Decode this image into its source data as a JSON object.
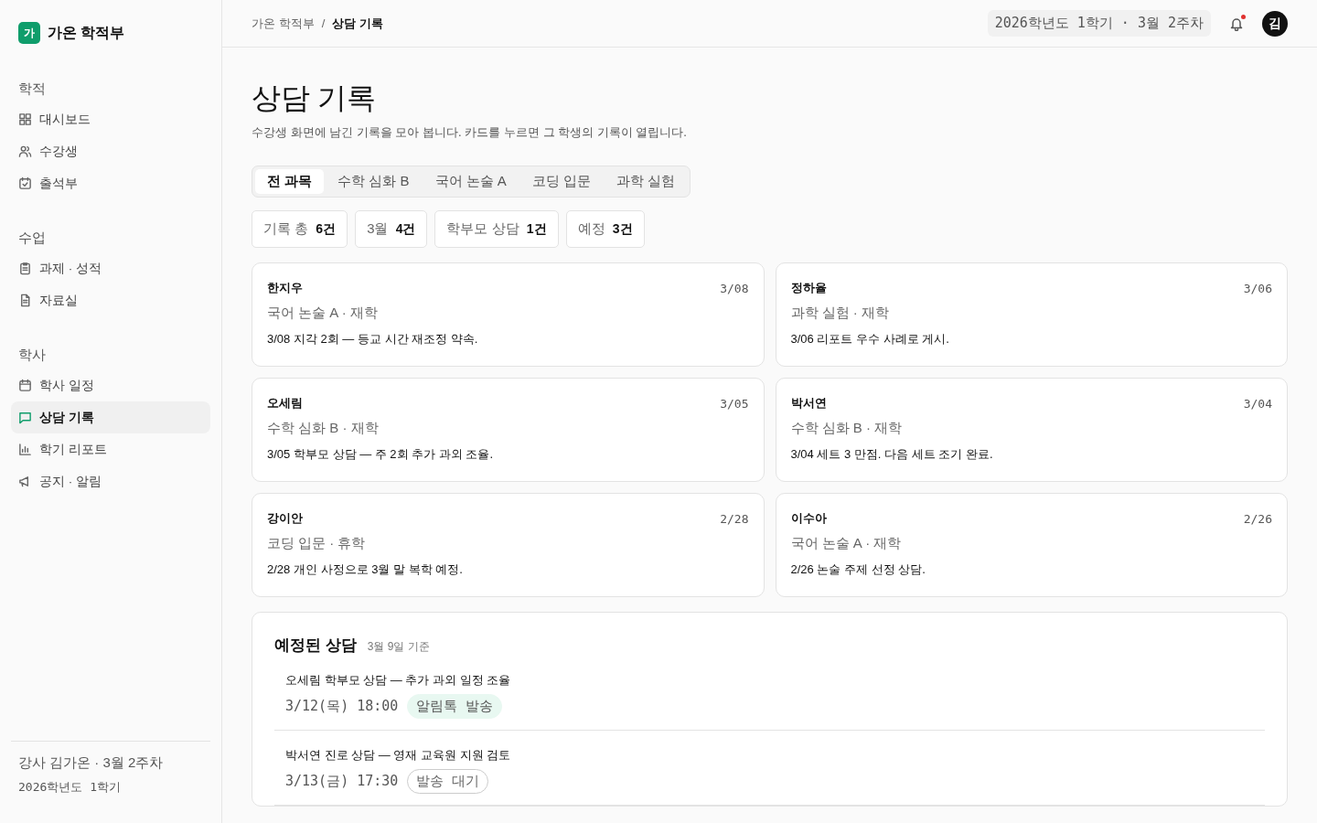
{
  "brand": {
    "logo": "가",
    "name": "가온 학적부"
  },
  "sidebar": {
    "sections": [
      {
        "title": "학적",
        "items": [
          {
            "label": "대시보드",
            "selected": false
          },
          {
            "label": "수강생",
            "selected": false
          },
          {
            "label": "출석부",
            "selected": false
          }
        ]
      },
      {
        "title": "수업",
        "items": [
          {
            "label": "과제 · 성적",
            "selected": false
          },
          {
            "label": "자료실",
            "selected": false
          }
        ]
      },
      {
        "title": "학사",
        "items": [
          {
            "label": "학사 일정",
            "selected": false
          },
          {
            "label": "상담 기록",
            "selected": true
          },
          {
            "label": "학기 리포트",
            "selected": false
          },
          {
            "label": "공지 · 알림",
            "selected": false
          }
        ]
      }
    ],
    "footer": {
      "user": "강사 김가온 · 3월 2주차",
      "term": "2026학년도 1학기"
    }
  },
  "header": {
    "breadcrumb": [
      "가온 학적부",
      "상담 기록"
    ],
    "breadcrumb_separator": "/",
    "term": "2026학년도 1학기 · 3월 2주차",
    "notifications_unread": true,
    "avatar": "김"
  },
  "page": {
    "title": "상담 기록",
    "subtitle": "수강생 화면에 남긴 기록을 모아 봅니다. 카드를 누르면 그 학생의 기록이 열립니다."
  },
  "tabs": [
    {
      "label": "전 과목",
      "selected": true
    },
    {
      "label": "수학 심화 B",
      "selected": false
    },
    {
      "label": "국어 논술 A",
      "selected": false
    },
    {
      "label": "코딩 입문",
      "selected": false
    },
    {
      "label": "과학 실험",
      "selected": false
    }
  ],
  "stats": [
    {
      "label": "기록 총",
      "value": "6건"
    },
    {
      "label": "3월",
      "value": "4건"
    },
    {
      "label": "학부모 상담",
      "value": "1건"
    },
    {
      "label": "예정",
      "value": "3건"
    }
  ],
  "records": [
    {
      "name": "한지우",
      "date": "3/08",
      "course": "국어 논술 A · 재학",
      "note": "3/08 지각 2회 — 등교 시간 재조정 약속."
    },
    {
      "name": "정하율",
      "date": "3/06",
      "course": "과학 실험 · 재학",
      "note": "3/06 리포트 우수 사례로 게시."
    },
    {
      "name": "오세림",
      "date": "3/05",
      "course": "수학 심화 B · 재학",
      "note": "3/05 학부모 상담 — 주 2회 추가 과외 조율."
    },
    {
      "name": "박서연",
      "date": "3/04",
      "course": "수학 심화 B · 재학",
      "note": "3/04 세트 3 만점. 다음 세트 조기 완료."
    },
    {
      "name": "강이안",
      "date": "2/28",
      "course": "코딩 입문 · 휴학",
      "note": "2/28 개인 사정으로 3월 말 복학 예정."
    },
    {
      "name": "이수아",
      "date": "2/26",
      "course": "국어 논술 A · 재학",
      "note": "2/26 논술 주제 선정 상담."
    }
  ],
  "scheduled": {
    "title": "예정된 상담",
    "basis": "3월 9일 기준",
    "items": [
      {
        "title": "오세림 학부모 상담 — 추가 과외 일정 조율",
        "when": "3/12(목) 18:00",
        "status": {
          "kind": "sent",
          "label": "알림톡 발송"
        }
      },
      {
        "title": "박서연 진로 상담 — 영재 교육원 지원 검토",
        "when": "3/13(금) 17:30",
        "status": {
          "kind": "pending",
          "label": "발송 대기"
        }
      }
    ]
  }
}
